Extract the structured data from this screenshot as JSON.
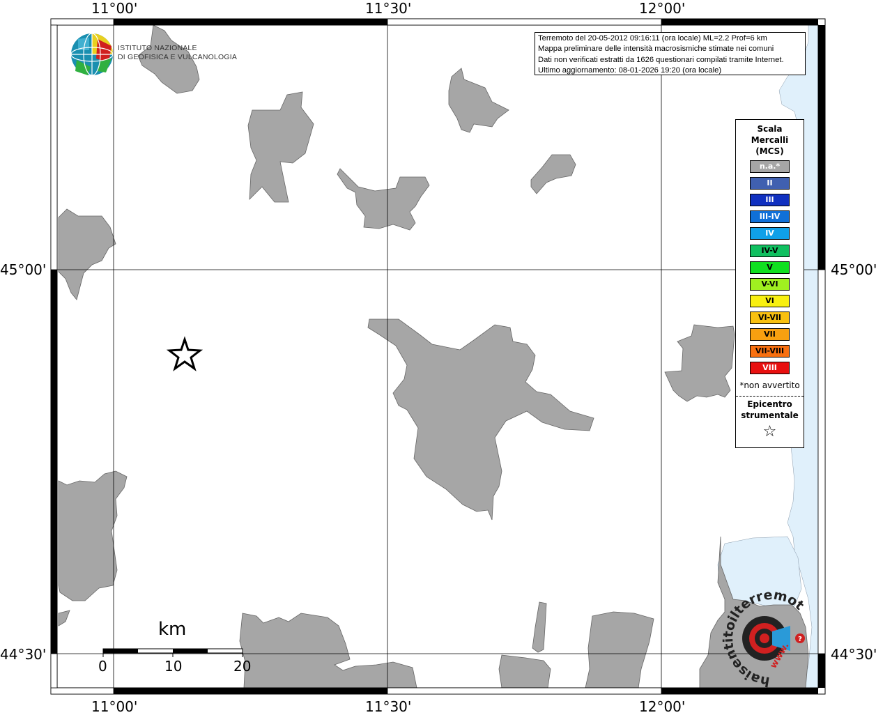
{
  "map": {
    "frame_labels": {
      "lon_top": [
        "11°00'",
        "11°30'",
        "12°00'"
      ],
      "lon_bottom": [
        "11°00'",
        "11°30'",
        "12°00'"
      ],
      "lat_left": [
        "45°00'",
        "44°30'"
      ],
      "lat_right": [
        "45°00'",
        "44°30'"
      ]
    },
    "colors": {
      "land": "#a6a6a6",
      "water": "#e0f0fb",
      "frame": "#000000"
    }
  },
  "logo": {
    "line1": "ISTITUTO NAZIONALE",
    "line2": "DI GEOFISICA E VULCANOLOGIA"
  },
  "info": {
    "line1": "Terremoto del 20-05-2012 09:16:11 (ora locale) ML=2.2 Prof=6 km",
    "line2": "Mappa preliminare delle intensità macrosismiche stimate nei comuni",
    "line3": "Dati non verificati estratti da 1626 questionari compilati tramite Internet.",
    "line4": "Ultimo aggiornamento: 08-01-2026 19:20 (ora locale)"
  },
  "legend": {
    "title_line1": "Scala",
    "title_line2": "Mercalli",
    "title_line3": "(MCS)",
    "items": [
      {
        "label": "n.a.*",
        "color": "#a6a6a6",
        "text_color": "#ffffff"
      },
      {
        "label": "II",
        "color": "#4060b0",
        "text_color": "#ffffff"
      },
      {
        "label": "III",
        "color": "#1030c0",
        "text_color": "#ffffff"
      },
      {
        "label": "III-IV",
        "color": "#1070d8",
        "text_color": "#ffffff"
      },
      {
        "label": "IV",
        "color": "#10a0e8",
        "text_color": "#ffffff"
      },
      {
        "label": "IV-V",
        "color": "#10c060",
        "text_color": "#000000"
      },
      {
        "label": "V",
        "color": "#10e020",
        "text_color": "#000000"
      },
      {
        "label": "V-VI",
        "color": "#a0f020",
        "text_color": "#000000"
      },
      {
        "label": "VI",
        "color": "#f8f010",
        "text_color": "#000000"
      },
      {
        "label": "VI-VII",
        "color": "#f8c010",
        "text_color": "#000000"
      },
      {
        "label": "VII",
        "color": "#f8a010",
        "text_color": "#000000"
      },
      {
        "label": "VII-VIII",
        "color": "#f87010",
        "text_color": "#000000"
      },
      {
        "label": "VIII",
        "color": "#e81010",
        "text_color": "#ffffff"
      }
    ],
    "note": "*non avvertito",
    "epicenter_line1": "Epicentro",
    "epicenter_line2": "strumentale",
    "epicenter_symbol": "☆"
  },
  "epicenter": {
    "symbol": "star-icon"
  },
  "scale_bar": {
    "unit": "km",
    "ticks": [
      "0",
      "10",
      "20"
    ]
  },
  "watermark": {
    "text": "haisentitoilterremoto.it",
    "sub": "www."
  }
}
